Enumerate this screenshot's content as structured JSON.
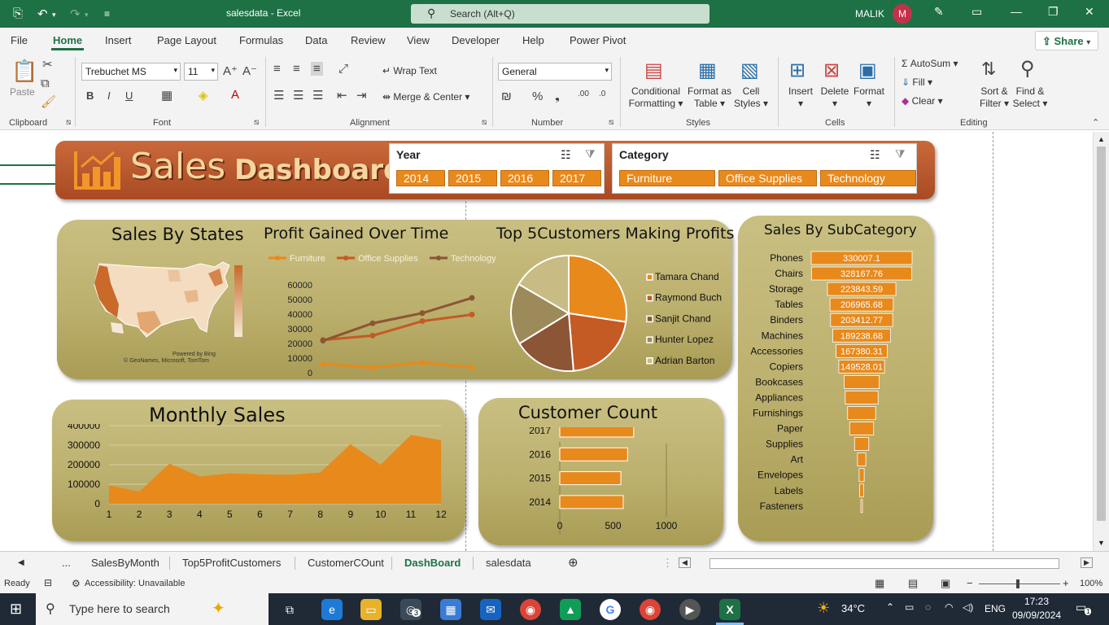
{
  "titlebar": {
    "document_title": "salesdata  -  Excel",
    "search_placeholder": "Search (Alt+Q)",
    "user_name": "MALIK",
    "user_initial": "M"
  },
  "menu": {
    "file": "File",
    "home": "Home",
    "insert": "Insert",
    "page_layout": "Page Layout",
    "formulas": "Formulas",
    "data": "Data",
    "review": "Review",
    "view": "View",
    "developer": "Developer",
    "help": "Help",
    "power_pivot": "Power Pivot",
    "share": "Share"
  },
  "ribbon": {
    "paste": "Paste",
    "clipboard": "Clipboard",
    "font_name": "Trebuchet MS",
    "font_size": "11",
    "font_group": "Font",
    "wrap_text": "Wrap Text",
    "merge_center": "Merge & Center",
    "alignment_group": "Alignment",
    "number_format": "General",
    "number_group": "Number",
    "conditional_formatting_1": "Conditional",
    "conditional_formatting_2": "Formatting",
    "format_as_table_1": "Format as",
    "format_as_table_2": "Table",
    "cell_styles_1": "Cell",
    "cell_styles_2": "Styles",
    "styles_group": "Styles",
    "insert": "Insert",
    "delete": "Delete",
    "format": "Format",
    "cells_group": "Cells",
    "autosum": "AutoSum",
    "fill": "Fill",
    "clear": "Clear",
    "sort_filter_1": "Sort &",
    "sort_filter_2": "Filter",
    "find_select_1": "Find &",
    "find_select_2": "Select",
    "editing_group": "Editing"
  },
  "dashboard": {
    "banner_title_1": "Sales",
    "banner_title_2": "Dashboard",
    "year_slicer": {
      "title": "Year",
      "items": [
        "2014",
        "2015",
        "2016",
        "2017"
      ]
    },
    "category_slicer": {
      "title": "Category",
      "items": [
        "Furniture",
        "Office Supplies",
        "Technology"
      ]
    },
    "sales_by_states": {
      "title": "Sales By States",
      "powered_by": "Powered by Bing",
      "copyright": "© GeoNames, Microsoft, TomTom"
    },
    "profit_over_time": {
      "title": "Profit Gained Over Time"
    },
    "top5": {
      "title": "Top 5Customers Making Profits"
    },
    "monthly_sales": {
      "title": "Monthly Sales"
    },
    "customer_count": {
      "title": "Customer Count"
    },
    "subcategory": {
      "title": "Sales By SubCategory"
    }
  },
  "chart_data": [
    {
      "type": "line",
      "title": "Profit Gained Over Time",
      "x": [
        "2014",
        "2015",
        "2016",
        "2017"
      ],
      "series": [
        {
          "name": "Furniture",
          "values": [
            5500,
            3000,
            6500,
            3000
          ]
        },
        {
          "name": "Office Supplies",
          "values": [
            22000,
            25000,
            35000,
            39500
          ]
        },
        {
          "name": "Technology",
          "values": [
            21500,
            33500,
            40500,
            51000
          ]
        }
      ],
      "ylim": [
        0,
        60000
      ],
      "yticks": [
        "60000",
        "50000",
        "40000",
        "30000",
        "20000",
        "10000",
        "0"
      ],
      "colors": [
        "#e8891c",
        "#c45a24",
        "#8c5535"
      ]
    },
    {
      "type": "pie",
      "title": "Top 5Customers Making Profits",
      "categories": [
        "Tamara Chand",
        "Raymond Buch",
        "Sanjit Chand",
        "Hunter Lopez",
        "Adrian Barton"
      ],
      "values": [
        8981,
        6976,
        5757,
        5622,
        5444
      ],
      "colors": [
        "#e8891c",
        "#c45a24",
        "#8c5535",
        "#9c8a5a",
        "#c8bb83"
      ]
    },
    {
      "type": "area",
      "title": "Monthly Sales",
      "x": [
        "1",
        "2",
        "3",
        "4",
        "5",
        "6",
        "7",
        "8",
        "9",
        "10",
        "11",
        "12"
      ],
      "values": [
        95000,
        62000,
        205000,
        140000,
        155000,
        151000,
        148000,
        160000,
        305000,
        200000,
        352000,
        325000
      ],
      "ylim": [
        0,
        400000
      ],
      "yticks": [
        "400000",
        "300000",
        "200000",
        "100000",
        "0"
      ],
      "color": "#e8891c"
    },
    {
      "type": "bar",
      "title": "Customer Count",
      "orientation": "horizontal",
      "categories": [
        "2017",
        "2016",
        "2015",
        "2014"
      ],
      "values": [
        693,
        636,
        573,
        595
      ],
      "xlim": [
        0,
        1000
      ],
      "xticks": [
        "0",
        "500",
        "1000"
      ],
      "color": "#e8891c"
    },
    {
      "type": "bar",
      "title": "Sales By SubCategory",
      "orientation": "funnel",
      "categories": [
        "Phones",
        "Chairs",
        "Storage",
        "Tables",
        "Binders",
        "Machines",
        "Accessories",
        "Copiers",
        "Bookcases",
        "Appliances",
        "Furnishings",
        "Paper",
        "Supplies",
        "Art",
        "Envelopes",
        "Labels",
        "Fasteners"
      ],
      "values": [
        330007.1,
        328167.76,
        223843.59,
        206965.68,
        203412.77,
        189238.68,
        167380.31,
        149528.01,
        114880,
        107532,
        91705,
        78479,
        46674,
        27119,
        16476,
        12486,
        3024
      ],
      "labels": [
        "330007.1",
        "328167.76",
        "223843.59",
        "206965.68",
        "203412.77",
        "189238.68",
        "167380.31",
        "149528.01",
        "",
        "",
        "",
        "",
        "",
        "",
        "",
        "",
        ""
      ],
      "color": "#e8891c"
    }
  ],
  "sheet_tabs": {
    "ellipsis": "...",
    "tabs": [
      "SalesByMonth",
      "Top5ProfitCustomers",
      "CustomerCOunt",
      "DashBoard",
      "salesdata"
    ]
  },
  "status": {
    "ready": "Ready",
    "accessibility": "Accessibility: Unavailable",
    "zoom": "100%"
  },
  "taskbar": {
    "search_placeholder": "Type here to search",
    "temperature": "34°C",
    "language": "ENG",
    "time": "17:23",
    "date": "09/09/2024",
    "notifications": "1",
    "chat_badge": "3"
  }
}
